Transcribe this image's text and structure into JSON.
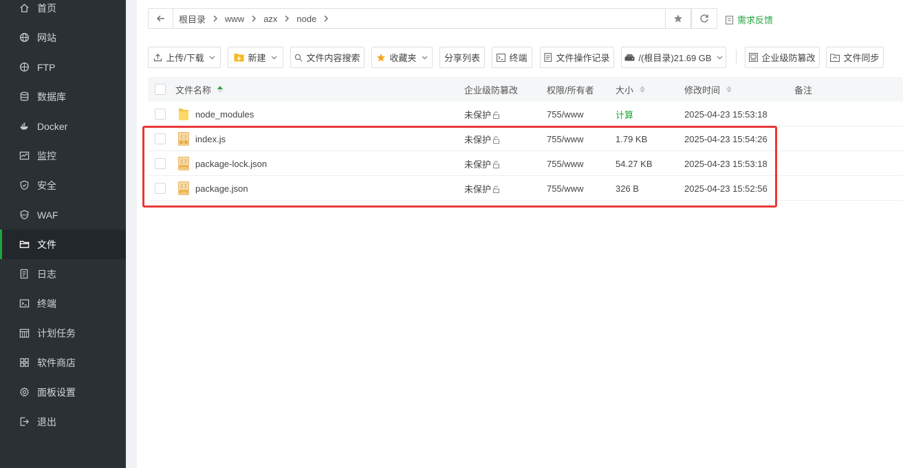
{
  "sidebar": {
    "items": [
      {
        "label": "首页",
        "icon": "home-icon",
        "active": false
      },
      {
        "label": "网站",
        "icon": "globe-icon",
        "active": false
      },
      {
        "label": "FTP",
        "icon": "ftp-icon",
        "active": false
      },
      {
        "label": "数据库",
        "icon": "database-icon",
        "active": false
      },
      {
        "label": "Docker",
        "icon": "docker-icon",
        "active": false
      },
      {
        "label": "监控",
        "icon": "monitor-icon",
        "active": false
      },
      {
        "label": "安全",
        "icon": "shield-icon",
        "active": false
      },
      {
        "label": "WAF",
        "icon": "waf-icon",
        "active": false
      },
      {
        "label": "文件",
        "icon": "folder-icon",
        "active": true
      },
      {
        "label": "日志",
        "icon": "log-icon",
        "active": false
      },
      {
        "label": "终端",
        "icon": "terminal-icon",
        "active": false
      },
      {
        "label": "计划任务",
        "icon": "calendar-icon",
        "active": false
      },
      {
        "label": "软件商店",
        "icon": "grid-icon",
        "active": false
      },
      {
        "label": "面板设置",
        "icon": "gear-icon",
        "active": false
      },
      {
        "label": "退出",
        "icon": "logout-icon",
        "active": false
      }
    ],
    "accent_color": "#20a53a"
  },
  "pathbar": {
    "crumbs": [
      "根目录",
      "www",
      "azx",
      "node"
    ],
    "feedback_label": "需求反馈"
  },
  "toolbar": {
    "upload_label": "上传/下载",
    "new_label": "新建",
    "search_label": "文件内容搜索",
    "favorites_label": "收藏夹",
    "share_label": "分享列表",
    "terminal_label": "终端",
    "oplog_label": "文件操作记录",
    "disk_label": "/(根目录)21.69 GB",
    "tamper_label": "企业级防篡改",
    "sync_label": "文件同步"
  },
  "table": {
    "headers": {
      "name": "文件名称",
      "tamper": "企业级防篡改",
      "perm": "权限/所有者",
      "size": "大小",
      "mtime": "修改时间",
      "note": "备注"
    },
    "rows": [
      {
        "name": "node_modules",
        "type": "folder",
        "tamper": "未保护",
        "perm": "755/www",
        "size": "计算",
        "mtime": "2025-04-23 15:53:18"
      },
      {
        "name": "index.js",
        "type": "js",
        "tamper": "未保护",
        "perm": "755/www",
        "size": "1.79 KB",
        "mtime": "2025-04-23 15:54:26"
      },
      {
        "name": "package-lock.json",
        "type": "json",
        "tamper": "未保护",
        "perm": "755/www",
        "size": "54.27 KB",
        "mtime": "2025-04-23 15:53:18"
      },
      {
        "name": "package.json",
        "type": "json",
        "tamper": "未保护",
        "perm": "755/www",
        "size": "326 B",
        "mtime": "2025-04-23 15:52:56"
      }
    ]
  },
  "highlight_color": "#e93737"
}
